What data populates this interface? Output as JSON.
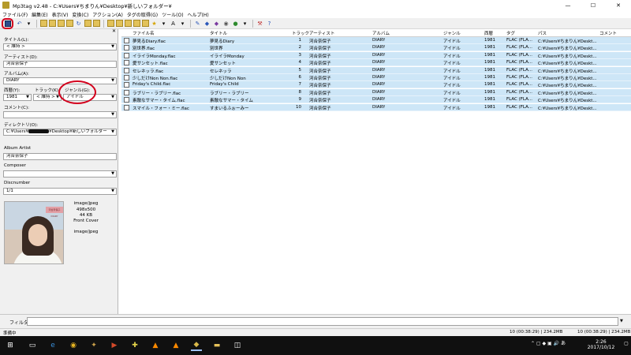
{
  "window": {
    "title": "Mp3tag v2.48 - C:¥Users¥ちまりん¥Desktop¥新しいフォルダー¥",
    "min": "—",
    "max": "☐",
    "close": "✕"
  },
  "menu": [
    "ファイル(F)",
    "編集(E)",
    "表示(V)",
    "変換(C)",
    "アクション(A)",
    "タグの取得(G)",
    "ツール(O)",
    "ヘルプ(H)"
  ],
  "left": {
    "close_x": "✕",
    "title_label": "タイトル(L):",
    "title_value": "< 維持 >",
    "artist_label": "アーティスト(D):",
    "artist_value": "河合奈保子",
    "album_label": "アルバム(A):",
    "album_value": "DIARY",
    "year_label": "西暦(Y):",
    "year_value": "1981",
    "track_label": "トラック(K):",
    "track_value": "< 維持 >",
    "genre_label": "ジャンル(G):",
    "genre_value": "アイドル",
    "comment_label": "コメント(C):",
    "comment_value": "",
    "directory_label": "ディレクトリ(O):",
    "directory_value": "C:¥Users¥",
    "directory_tail": "¥Desktop¥新しいフォルダー",
    "album_artist_label": "Album Artist",
    "album_artist_value": "河合奈保子",
    "composer_label": "Composer",
    "composer_value": "",
    "discnumber_label": "Discnumber",
    "discnumber_value": "1/1",
    "cover": {
      "mime": "image/jpeg",
      "size": "498x500",
      "kb": "44 KB",
      "type": "Front Cover",
      "mime2": "image/jpeg",
      "band_text": "河合奈保子 DIARY"
    }
  },
  "columns": [
    "ファイル名",
    "タイトル",
    "トラック",
    "アーティスト",
    "アルバム",
    "ジャンル",
    "西暦",
    "タグ",
    "パス",
    "コメント"
  ],
  "rows": [
    {
      "file": "夢見るDiary.flac",
      "title": "夢見るDiary",
      "track": "1",
      "artist": "河合奈保子",
      "album": "DIARY",
      "genre": "アイドル",
      "year": "1981",
      "tag": "FLAC (FLA...",
      "path": "C:¥Users¥ちまりん¥Deskt..."
    },
    {
      "file": "別世界.flac",
      "title": "別世界",
      "track": "2",
      "artist": "河合奈保子",
      "album": "DIARY",
      "genre": "アイドル",
      "year": "1981",
      "tag": "FLAC (FLA...",
      "path": "C:¥Users¥ちまりん¥Deskt..."
    },
    {
      "file": "イライラMonday.flac",
      "title": "イライラMonday",
      "track": "3",
      "artist": "河合奈保子",
      "album": "DIARY",
      "genre": "アイドル",
      "year": "1981",
      "tag": "FLAC (FLA...",
      "path": "C:¥Users¥ちまりん¥Deskt..."
    },
    {
      "file": "愛サンセット.flac",
      "title": "愛サンセット",
      "track": "4",
      "artist": "河合奈保子",
      "album": "DIARY",
      "genre": "アイドル",
      "year": "1981",
      "tag": "FLAC (FLA...",
      "path": "C:¥Users¥ちまりん¥Deskt..."
    },
    {
      "file": "セレネッラ.flac",
      "title": "セレネッラ",
      "track": "5",
      "artist": "河合奈保子",
      "album": "DIARY",
      "genre": "アイドル",
      "year": "1981",
      "tag": "FLAC (FLA...",
      "path": "C:¥Users¥ちまりん¥Deskt..."
    },
    {
      "file": "少しだけNon Non.flac",
      "title": "少しだけNon Non",
      "track": "6",
      "artist": "河合奈保子",
      "album": "DIARY",
      "genre": "アイドル",
      "year": "1981",
      "tag": "FLAC (FLA...",
      "path": "C:¥Users¥ちまりん¥Deskt..."
    },
    {
      "file": "Friday's Child.flac",
      "title": "Friday's Child",
      "track": "7",
      "artist": "河合奈保子",
      "album": "DIARY",
      "genre": "アイドル",
      "year": "1981",
      "tag": "FLAC (FLA...",
      "path": "C:¥Users¥ちまりん¥Deskt..."
    },
    {
      "file": "ラブリー・ラブリー.flac",
      "title": "ラブリー・ラブリー",
      "track": "8",
      "artist": "河合奈保子",
      "album": "DIARY",
      "genre": "アイドル",
      "year": "1981",
      "tag": "FLAC (FLA...",
      "path": "C:¥Users¥ちまりん¥Deskt..."
    },
    {
      "file": "素敵なサマー・タイム.flac",
      "title": "素敵なサマー・タイム",
      "track": "9",
      "artist": "河合奈保子",
      "album": "DIARY",
      "genre": "アイドル",
      "year": "1981",
      "tag": "FLAC (FLA...",
      "path": "C:¥Users¥ちまりん¥Deskt..."
    },
    {
      "file": "スマイル・フォー・ミー.flac",
      "title": "すまいるふぉーみー",
      "track": "10",
      "artist": "河合奈保子",
      "album": "DIARY",
      "genre": "アイドル",
      "year": "1981",
      "tag": "FLAC (FLA...",
      "path": "C:¥Users¥ちまりん¥Deskt..."
    }
  ],
  "filter": {
    "label": "フィルタ:",
    "value": ""
  },
  "status": {
    "left": "準備中",
    "mid": "10 (00:38:29) | 234.2MB",
    "right": "10 (00:38:29) | 234.2MB"
  },
  "taskbar": {
    "time": "2:26",
    "date": "2017/10/12"
  },
  "colors": {
    "selected_row": "#cde6f7",
    "annotation_red": "#d3001c"
  }
}
